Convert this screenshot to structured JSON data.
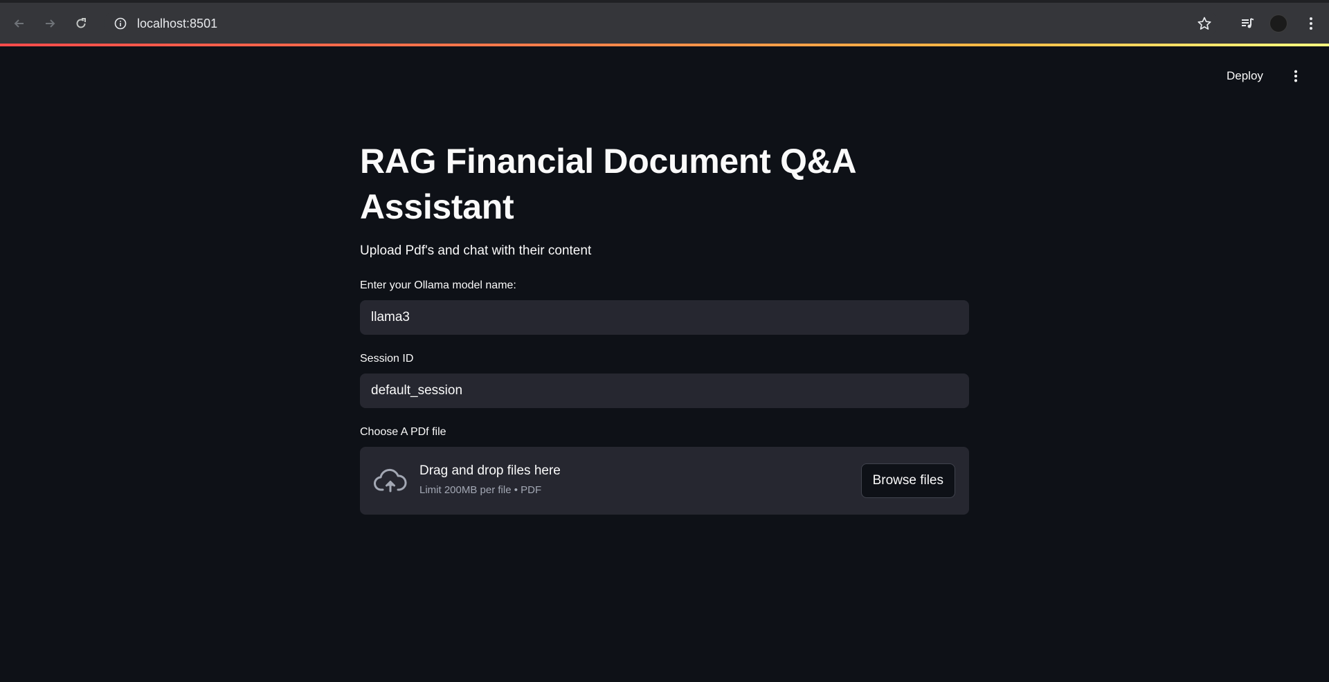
{
  "browser": {
    "url": "localhost:8501"
  },
  "app_header": {
    "deploy_label": "Deploy"
  },
  "main": {
    "title": "RAG Financial Document Q&A Assistant",
    "subtitle": "Upload Pdf's and chat with their content",
    "model_field": {
      "label": "Enter your Ollama model name:",
      "value": "llama3"
    },
    "session_field": {
      "label": "Session ID",
      "value": "default_session"
    },
    "uploader": {
      "label": "Choose A PDf file",
      "drag_text": "Drag and drop files here",
      "limit_text": "Limit 200MB per file • PDF",
      "browse_label": "Browse files"
    }
  },
  "colors": {
    "background": "#0e1117",
    "input_background": "#262730",
    "accent_gradient_start": "#ff4b4b",
    "accent_gradient_end": "#fffd80"
  }
}
